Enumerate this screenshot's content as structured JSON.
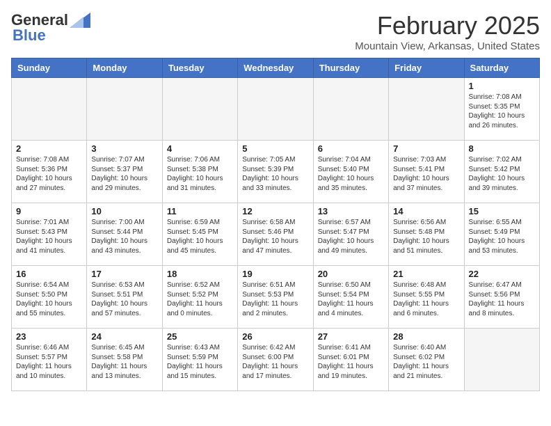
{
  "header": {
    "logo_general": "General",
    "logo_blue": "Blue",
    "title": "February 2025",
    "subtitle": "Mountain View, Arkansas, United States"
  },
  "weekdays": [
    "Sunday",
    "Monday",
    "Tuesday",
    "Wednesday",
    "Thursday",
    "Friday",
    "Saturday"
  ],
  "weeks": [
    [
      {
        "day": "",
        "info": ""
      },
      {
        "day": "",
        "info": ""
      },
      {
        "day": "",
        "info": ""
      },
      {
        "day": "",
        "info": ""
      },
      {
        "day": "",
        "info": ""
      },
      {
        "day": "",
        "info": ""
      },
      {
        "day": "1",
        "info": "Sunrise: 7:08 AM\nSunset: 5:35 PM\nDaylight: 10 hours and 26 minutes."
      }
    ],
    [
      {
        "day": "2",
        "info": "Sunrise: 7:08 AM\nSunset: 5:36 PM\nDaylight: 10 hours and 27 minutes."
      },
      {
        "day": "3",
        "info": "Sunrise: 7:07 AM\nSunset: 5:37 PM\nDaylight: 10 hours and 29 minutes."
      },
      {
        "day": "4",
        "info": "Sunrise: 7:06 AM\nSunset: 5:38 PM\nDaylight: 10 hours and 31 minutes."
      },
      {
        "day": "5",
        "info": "Sunrise: 7:05 AM\nSunset: 5:39 PM\nDaylight: 10 hours and 33 minutes."
      },
      {
        "day": "6",
        "info": "Sunrise: 7:04 AM\nSunset: 5:40 PM\nDaylight: 10 hours and 35 minutes."
      },
      {
        "day": "7",
        "info": "Sunrise: 7:03 AM\nSunset: 5:41 PM\nDaylight: 10 hours and 37 minutes."
      },
      {
        "day": "8",
        "info": "Sunrise: 7:02 AM\nSunset: 5:42 PM\nDaylight: 10 hours and 39 minutes."
      }
    ],
    [
      {
        "day": "9",
        "info": "Sunrise: 7:01 AM\nSunset: 5:43 PM\nDaylight: 10 hours and 41 minutes."
      },
      {
        "day": "10",
        "info": "Sunrise: 7:00 AM\nSunset: 5:44 PM\nDaylight: 10 hours and 43 minutes."
      },
      {
        "day": "11",
        "info": "Sunrise: 6:59 AM\nSunset: 5:45 PM\nDaylight: 10 hours and 45 minutes."
      },
      {
        "day": "12",
        "info": "Sunrise: 6:58 AM\nSunset: 5:46 PM\nDaylight: 10 hours and 47 minutes."
      },
      {
        "day": "13",
        "info": "Sunrise: 6:57 AM\nSunset: 5:47 PM\nDaylight: 10 hours and 49 minutes."
      },
      {
        "day": "14",
        "info": "Sunrise: 6:56 AM\nSunset: 5:48 PM\nDaylight: 10 hours and 51 minutes."
      },
      {
        "day": "15",
        "info": "Sunrise: 6:55 AM\nSunset: 5:49 PM\nDaylight: 10 hours and 53 minutes."
      }
    ],
    [
      {
        "day": "16",
        "info": "Sunrise: 6:54 AM\nSunset: 5:50 PM\nDaylight: 10 hours and 55 minutes."
      },
      {
        "day": "17",
        "info": "Sunrise: 6:53 AM\nSunset: 5:51 PM\nDaylight: 10 hours and 57 minutes."
      },
      {
        "day": "18",
        "info": "Sunrise: 6:52 AM\nSunset: 5:52 PM\nDaylight: 11 hours and 0 minutes."
      },
      {
        "day": "19",
        "info": "Sunrise: 6:51 AM\nSunset: 5:53 PM\nDaylight: 11 hours and 2 minutes."
      },
      {
        "day": "20",
        "info": "Sunrise: 6:50 AM\nSunset: 5:54 PM\nDaylight: 11 hours and 4 minutes."
      },
      {
        "day": "21",
        "info": "Sunrise: 6:48 AM\nSunset: 5:55 PM\nDaylight: 11 hours and 6 minutes."
      },
      {
        "day": "22",
        "info": "Sunrise: 6:47 AM\nSunset: 5:56 PM\nDaylight: 11 hours and 8 minutes."
      }
    ],
    [
      {
        "day": "23",
        "info": "Sunrise: 6:46 AM\nSunset: 5:57 PM\nDaylight: 11 hours and 10 minutes."
      },
      {
        "day": "24",
        "info": "Sunrise: 6:45 AM\nSunset: 5:58 PM\nDaylight: 11 hours and 13 minutes."
      },
      {
        "day": "25",
        "info": "Sunrise: 6:43 AM\nSunset: 5:59 PM\nDaylight: 11 hours and 15 minutes."
      },
      {
        "day": "26",
        "info": "Sunrise: 6:42 AM\nSunset: 6:00 PM\nDaylight: 11 hours and 17 minutes."
      },
      {
        "day": "27",
        "info": "Sunrise: 6:41 AM\nSunset: 6:01 PM\nDaylight: 11 hours and 19 minutes."
      },
      {
        "day": "28",
        "info": "Sunrise: 6:40 AM\nSunset: 6:02 PM\nDaylight: 11 hours and 21 minutes."
      },
      {
        "day": "",
        "info": ""
      }
    ]
  ]
}
